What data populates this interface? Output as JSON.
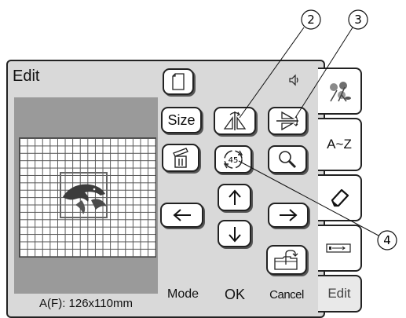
{
  "screen": {
    "title": "Edit",
    "size_label": "A(F): 126x110mm"
  },
  "buttons": {
    "size": "Size",
    "mode": "Mode",
    "ok": "OK",
    "cancel": "Cancel"
  },
  "rotate_angle": "45",
  "tabs": {
    "edit": "Edit",
    "alpha": "A~Z"
  },
  "callouts": [
    "2",
    "3",
    "4"
  ],
  "icons": [
    "speaker-icon",
    "new-page-icon",
    "flip-horizontal-icon",
    "flip-vertical-icon",
    "delete-icon",
    "rotate-icon",
    "zoom-icon",
    "arrow-up-icon",
    "arrow-down-icon",
    "arrow-left-icon",
    "arrow-right-icon",
    "memory-icon",
    "embroidery-flowers-icon",
    "eraser-icon",
    "usb-icon"
  ]
}
